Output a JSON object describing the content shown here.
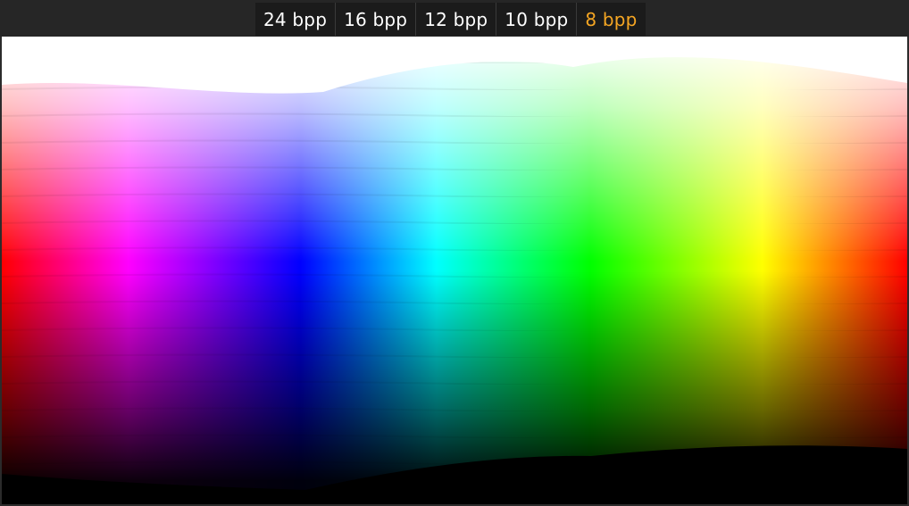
{
  "tabs": [
    {
      "label": "24 bpp",
      "active": false
    },
    {
      "label": "16 bpp",
      "active": false
    },
    {
      "label": "12 bpp",
      "active": false
    },
    {
      "label": "10 bpp",
      "active": false
    },
    {
      "label": "8 bpp",
      "active": true
    }
  ],
  "colors": {
    "active_tab": "#f5a623",
    "tab_text": "#ffffff",
    "toolbar_bg": "#1b1b1b"
  },
  "image": {
    "description_icon": "color-gradient-image",
    "bit_depth_selected": "8 bpp"
  }
}
